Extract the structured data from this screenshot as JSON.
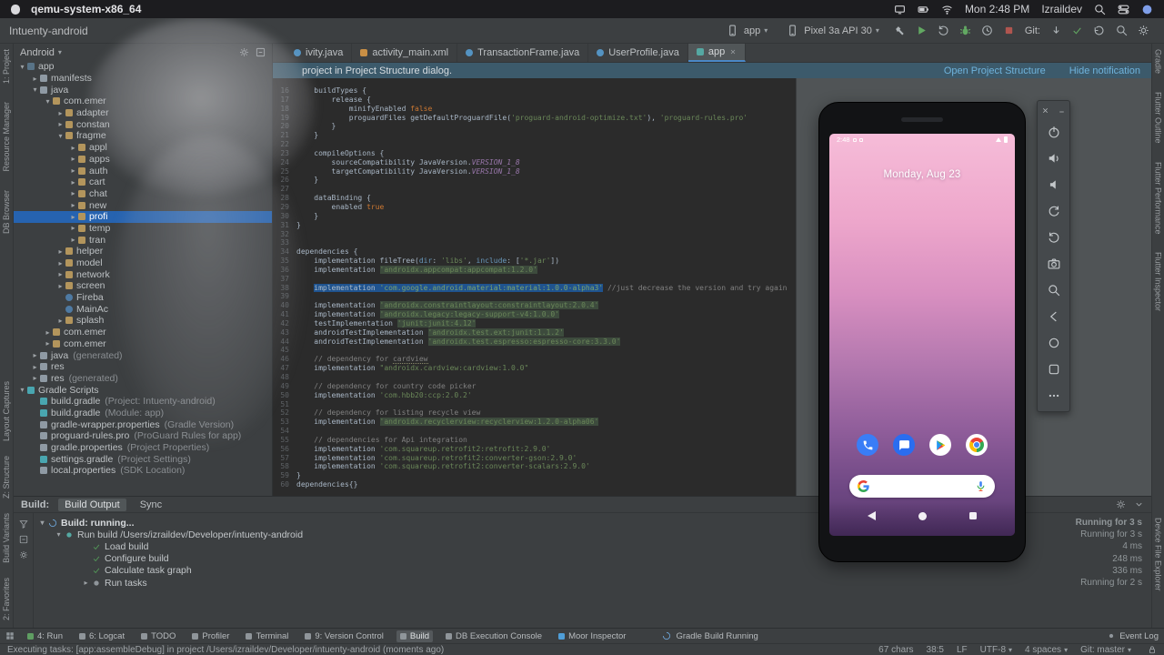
{
  "menubar": {
    "app_name": "qemu-system-x86_64",
    "time": "Mon 2:48 PM",
    "user": "Izraildev",
    "status_icons": [
      {
        "i": "display",
        "n": "display-icon"
      },
      {
        "i": "battery",
        "n": "battery-icon"
      },
      {
        "i": "wifi",
        "n": "wifi-icon"
      }
    ]
  },
  "toolbar": {
    "project": "Intuenty-android",
    "run_config": "app",
    "device": "Pixel 3a API 30",
    "git_label": "Git:",
    "actions": [
      {
        "i": "hammer",
        "n": "build-hammer-icon",
        "cls": "c-gray"
      },
      {
        "i": "play",
        "n": "run-icon",
        "cls": "c-green"
      },
      {
        "i": "rotate-right",
        "n": "apply-changes-icon",
        "cls": "c-gray"
      },
      {
        "i": "bug",
        "n": "debug-icon",
        "cls": "c-green"
      },
      {
        "i": "clock",
        "n": "profile-icon",
        "cls": "c-gray"
      },
      {
        "i": "stop",
        "n": "stop-icon",
        "cls": "c-red"
      }
    ],
    "git_icons": [
      {
        "i": "arrow-down",
        "n": "git-update-icon",
        "cls": "c-gray"
      },
      {
        "i": "check",
        "n": "git-commit-icon",
        "cls": "c-green"
      },
      {
        "i": "undo",
        "n": "git-rollback-icon",
        "cls": "c-gray"
      }
    ],
    "trailing_icons": [
      {
        "i": "search",
        "n": "search-icon",
        "cls": "c-gray"
      },
      {
        "i": "gear",
        "n": "settings-icon",
        "cls": "c-gray"
      }
    ]
  },
  "left_strip_top": [
    "1: Project",
    "Resource Manager",
    "DB Browser"
  ],
  "left_strip_bottom": [
    "Layout Captures",
    "Z: Structure",
    "Build Variants",
    "2: Favorites"
  ],
  "right_strip_top": [
    "Gradle",
    "Flutter Outline",
    "Flutter Performance",
    "Flutter Inspector"
  ],
  "right_strip_bottom": [
    "Device File Explorer"
  ],
  "project_panel": {
    "scope": "Android",
    "tree": [
      {
        "l": "app",
        "cls": "d0",
        "ic": "ic-app",
        "a": "▾"
      },
      {
        "l": "manifests",
        "cls": "d1",
        "ic": "ic-folder",
        "a": "▸"
      },
      {
        "l": "java",
        "cls": "d1",
        "ic": "ic-folder",
        "a": "▾"
      },
      {
        "l": "com.emer",
        "cls": "d2",
        "ic": "ic-pkg",
        "a": "▾"
      },
      {
        "l": "adapter",
        "cls": "d3",
        "ic": "ic-pkg",
        "a": "▸"
      },
      {
        "l": "constan",
        "cls": "d3",
        "ic": "ic-pkg",
        "a": "▸"
      },
      {
        "l": "fragme",
        "cls": "d3",
        "ic": "ic-pkg",
        "a": "▾"
      },
      {
        "l": "appl",
        "cls": "d4",
        "ic": "ic-pkg",
        "a": "▸"
      },
      {
        "l": "apps",
        "cls": "d4",
        "ic": "ic-pkg",
        "a": "▸"
      },
      {
        "l": "auth",
        "cls": "d4",
        "ic": "ic-pkg",
        "a": "▸"
      },
      {
        "l": "cart",
        "cls": "d4",
        "ic": "ic-pkg",
        "a": "▸"
      },
      {
        "l": "chat",
        "cls": "d4",
        "ic": "ic-pkg",
        "a": "▸"
      },
      {
        "l": "new",
        "cls": "d4",
        "ic": "ic-pkg",
        "a": "▸"
      },
      {
        "l": "profi",
        "cls": "d4 selected",
        "ic": "ic-pkg",
        "a": "▸"
      },
      {
        "l": "temp",
        "cls": "d4",
        "ic": "ic-pkg",
        "a": "▸"
      },
      {
        "l": "tran",
        "cls": "d4",
        "ic": "ic-pkg",
        "a": "▸"
      },
      {
        "l": "helper",
        "cls": "d3",
        "ic": "ic-pkg",
        "a": "▸"
      },
      {
        "l": "model",
        "cls": "d3",
        "ic": "ic-pkg",
        "a": "▸"
      },
      {
        "l": "network",
        "cls": "d3",
        "ic": "ic-pkg",
        "a": "▸"
      },
      {
        "l": "screen",
        "cls": "d3",
        "ic": "ic-pkg",
        "a": "▸"
      },
      {
        "l": "Fireba",
        "cls": "d3",
        "ic": "ic-cls"
      },
      {
        "l": "MainAc",
        "cls": "d3",
        "ic": "ic-cls"
      },
      {
        "l": "splash",
        "cls": "d3",
        "ic": "ic-pkg",
        "a": "▸"
      },
      {
        "l": "com.emer",
        "cls": "d2",
        "ic": "ic-pkg",
        "a": "▸"
      },
      {
        "l": "com.emer",
        "cls": "d2",
        "ic": "ic-pkg",
        "a": "▸"
      },
      {
        "l": "java",
        "suf": "(generated)",
        "cls": "d1",
        "ic": "ic-folder",
        "a": "▸"
      },
      {
        "l": "res",
        "cls": "d1",
        "ic": "ic-folder",
        "a": "▸"
      },
      {
        "l": "res",
        "suf": "(generated)",
        "cls": "d1",
        "ic": "ic-folder",
        "a": "▸"
      },
      {
        "l": "Gradle Scripts",
        "cls": "d0",
        "ic": "ic-gradle",
        "a": "▾"
      },
      {
        "l": "build.gradle",
        "suf": "(Project: Intuenty-android)",
        "cls": "d1",
        "ic": "ic-gradle"
      },
      {
        "l": "build.gradle",
        "suf": "(Module: app)",
        "cls": "d1",
        "ic": "ic-gradle"
      },
      {
        "l": "gradle-wrapper.properties",
        "suf": "(Gradle Version)",
        "cls": "d1",
        "ic": "ic-props"
      },
      {
        "l": "proguard-rules.pro",
        "suf": "(ProGuard Rules for app)",
        "cls": "d1",
        "ic": "ic-pro"
      },
      {
        "l": "gradle.properties",
        "suf": "(Project Properties)",
        "cls": "d1",
        "ic": "ic-props"
      },
      {
        "l": "settings.gradle",
        "suf": "(Project Settings)",
        "cls": "d1",
        "ic": "ic-gradle"
      },
      {
        "l": "local.properties",
        "suf": "(SDK Location)",
        "cls": "d1",
        "ic": "ic-props"
      }
    ]
  },
  "tabs": [
    {
      "label": "ivity.java",
      "ic": "ti-java"
    },
    {
      "label": "activity_main.xml",
      "ic": "ti-xml"
    },
    {
      "label": "TransactionFrame.java",
      "ic": "ti-java"
    },
    {
      "label": "UserProfile.java",
      "ic": "ti-java"
    },
    {
      "label": "app",
      "ic": "ti-gradle",
      "cls": "active",
      "close": true
    }
  ],
  "notification": {
    "text": "project in Project Structure dialog.",
    "links": [
      "Open Project Structure",
      "Hide notification"
    ]
  },
  "editor": {
    "lines": [
      {
        "g": 16,
        "s": [
          {
            "t": "    buildTypes {",
            "c": "pln"
          }
        ]
      },
      {
        "g": 17,
        "s": [
          {
            "t": "        release {",
            "c": "pln"
          }
        ]
      },
      {
        "g": 18,
        "s": [
          {
            "t": "            minifyEnabled ",
            "c": "pln"
          },
          {
            "t": "false",
            "c": "kw"
          }
        ]
      },
      {
        "g": 19,
        "s": [
          {
            "t": "            proguardFiles getDefaultProguardFile(",
            "c": "pln"
          },
          {
            "t": "'proguard-android-optimize.txt'",
            "c": "str"
          },
          {
            "t": "), ",
            "c": "pln"
          },
          {
            "t": "'proguard-rules.pro'",
            "c": "str"
          }
        ]
      },
      {
        "g": 20,
        "s": [
          {
            "t": "        }",
            "c": "pln"
          }
        ]
      },
      {
        "g": 21,
        "s": [
          {
            "t": "    }",
            "c": "pln"
          }
        ]
      },
      {
        "g": 22,
        "s": []
      },
      {
        "g": 23,
        "s": [
          {
            "t": "    compileOptions {",
            "c": "pln"
          }
        ]
      },
      {
        "g": 24,
        "s": [
          {
            "t": "        sourceCompatibility JavaVersion.",
            "c": "pln"
          },
          {
            "t": "VERSION_1_8",
            "c": "cst"
          }
        ]
      },
      {
        "g": 25,
        "s": [
          {
            "t": "        targetCompatibility JavaVersion.",
            "c": "pln"
          },
          {
            "t": "VERSION_1_8",
            "c": "cst"
          }
        ]
      },
      {
        "g": 26,
        "s": [
          {
            "t": "    }",
            "c": "pln"
          }
        ]
      },
      {
        "g": 27,
        "s": []
      },
      {
        "g": 28,
        "s": [
          {
            "t": "    dataBinding {",
            "c": "pln"
          }
        ]
      },
      {
        "g": 29,
        "s": [
          {
            "t": "        enabled ",
            "c": "pln"
          },
          {
            "t": "true",
            "c": "kw"
          }
        ]
      },
      {
        "g": 30,
        "s": [
          {
            "t": "    }",
            "c": "pln"
          }
        ]
      },
      {
        "g": 31,
        "s": [
          {
            "t": "}",
            "c": "pln"
          }
        ]
      },
      {
        "g": 32,
        "s": []
      },
      {
        "g": 33,
        "s": []
      },
      {
        "g": 34,
        "s": [
          {
            "t": "dependencies {",
            "c": "pln"
          }
        ]
      },
      {
        "g": 35,
        "s": [
          {
            "t": "    implementation fileTree(",
            "c": "pln"
          },
          {
            "t": "dir",
            "c": "prm"
          },
          {
            "t": ": ",
            "c": "pln"
          },
          {
            "t": "'libs'",
            "c": "str"
          },
          {
            "t": ", ",
            "c": "pln"
          },
          {
            "t": "include",
            "c": "prm"
          },
          {
            "t": ": [",
            "c": "pln"
          },
          {
            "t": "'*.jar'",
            "c": "str"
          },
          {
            "t": "])",
            "c": "pln"
          }
        ]
      },
      {
        "g": 36,
        "s": [
          {
            "t": "    implementation ",
            "c": "pln"
          },
          {
            "t": "'androidx.appcompat:appcompat:1.2.0'",
            "c": "strh"
          }
        ]
      },
      {
        "g": 37,
        "s": []
      },
      {
        "g": 38,
        "s": [
          {
            "t": "    ",
            "c": "pln"
          },
          {
            "t": "implementation ",
            "c": "sel"
          },
          {
            "t": "'com.google.android.material:material:1.0.0-alpha3'",
            "c": "selstr"
          },
          {
            "t": " ",
            "c": "pln"
          },
          {
            "t": "//just decrease the version and try again",
            "c": "cmt"
          }
        ]
      },
      {
        "g": 39,
        "s": []
      },
      {
        "g": 40,
        "s": [
          {
            "t": "    implementation ",
            "c": "pln"
          },
          {
            "t": "'androidx.constraintlayout:constraintlayout:2.0.4'",
            "c": "strh"
          }
        ]
      },
      {
        "g": 41,
        "s": [
          {
            "t": "    implementation ",
            "c": "pln"
          },
          {
            "t": "'androidx.legacy:legacy-support-v4:1.0.0'",
            "c": "strh"
          }
        ]
      },
      {
        "g": 42,
        "s": [
          {
            "t": "    testImplementation ",
            "c": "pln"
          },
          {
            "t": "'junit:junit:4.12'",
            "c": "strh"
          }
        ]
      },
      {
        "g": 43,
        "s": [
          {
            "t": "    androidTestImplementation ",
            "c": "pln"
          },
          {
            "t": "'androidx.test.ext:junit:1.1.2'",
            "c": "strh"
          }
        ]
      },
      {
        "g": 44,
        "s": [
          {
            "t": "    androidTestImplementation ",
            "c": "pln"
          },
          {
            "t": "'androidx.test.espresso:espresso-core:3.3.0'",
            "c": "strh"
          }
        ]
      },
      {
        "g": 45,
        "s": []
      },
      {
        "g": 46,
        "s": [
          {
            "t": "    ",
            "c": "pln"
          },
          {
            "t": "// dependency for ",
            "c": "cmt"
          },
          {
            "t": "cardview",
            "c": "cmt u"
          }
        ]
      },
      {
        "g": 47,
        "s": [
          {
            "t": "    implementation ",
            "c": "pln"
          },
          {
            "t": "\"androidx.cardview:cardview:1.0.0\"",
            "c": "str"
          }
        ]
      },
      {
        "g": 48,
        "s": []
      },
      {
        "g": 49,
        "s": [
          {
            "t": "    ",
            "c": "pln"
          },
          {
            "t": "// dependency for country code picker",
            "c": "cmt"
          }
        ]
      },
      {
        "g": 50,
        "s": [
          {
            "t": "    implementation ",
            "c": "pln"
          },
          {
            "t": "'com.hbb20:ccp:2.0.2'",
            "c": "str"
          }
        ]
      },
      {
        "g": 51,
        "s": []
      },
      {
        "g": 52,
        "s": [
          {
            "t": "    ",
            "c": "pln"
          },
          {
            "t": "// dependency for listing recycle view",
            "c": "cmt"
          }
        ]
      },
      {
        "g": 53,
        "s": [
          {
            "t": "    implementation ",
            "c": "pln"
          },
          {
            "t": "'androidx.recyclerview:recyclerview:1.2.0-alpha06'",
            "c": "strh"
          }
        ]
      },
      {
        "g": 54,
        "s": []
      },
      {
        "g": 55,
        "s": [
          {
            "t": "    ",
            "c": "pln"
          },
          {
            "t": "// dependencies for Api integration",
            "c": "cmt"
          }
        ]
      },
      {
        "g": 56,
        "s": [
          {
            "t": "    implementation ",
            "c": "pln"
          },
          {
            "t": "'com.squareup.retrofit2:retrofit:2.9.0'",
            "c": "str"
          }
        ]
      },
      {
        "g": 57,
        "s": [
          {
            "t": "    implementation ",
            "c": "pln"
          },
          {
            "t": "'com.squareup.retrofit2:converter-gson:2.9.0'",
            "c": "str"
          }
        ]
      },
      {
        "g": 58,
        "s": [
          {
            "t": "    implementation ",
            "c": "pln"
          },
          {
            "t": "'com.squareup.retrofit2:converter-scalars:2.9.0'",
            "c": "str"
          }
        ]
      },
      {
        "g": 59,
        "s": [
          {
            "t": "}",
            "c": "pln"
          }
        ]
      },
      {
        "g": 60,
        "s": [
          {
            "t": "dependencies{}",
            "c": "pln"
          }
        ]
      }
    ]
  },
  "emulator": {
    "controls": [
      {
        "i": "power",
        "n": "power-button"
      },
      {
        "i": "volume-up",
        "n": "volume-up-button"
      },
      {
        "i": "volume-down",
        "n": "volume-down-button"
      },
      {
        "i": "rotate-left",
        "n": "rotate-left-button"
      },
      {
        "i": "rotate-right",
        "n": "rotate-right-button"
      },
      {
        "i": "camera",
        "n": "screenshot-button"
      },
      {
        "i": "zoom",
        "n": "zoom-button"
      },
      {
        "i": "back-nav",
        "n": "back-button"
      },
      {
        "i": "home-nav",
        "n": "home-button"
      },
      {
        "i": "overview-nav",
        "n": "overview-button"
      },
      {
        "i": "more",
        "n": "more-button"
      }
    ],
    "phone": {
      "status_time": "2:48",
      "date": "Monday, Aug 23",
      "dock": [
        {
          "ic": "phone-call",
          "cls": "di-phone",
          "n": "phone-app-icon"
        },
        {
          "ic": "chat",
          "cls": "di-msg",
          "n": "messages-app-icon"
        },
        {
          "ic": "gplay",
          "cls": "di-play",
          "n": "play-store-app-icon"
        },
        {
          "ic": "chrome",
          "cls": "di-chrome",
          "n": "chrome-app-icon"
        }
      ]
    }
  },
  "build_panel": {
    "label": "Build:",
    "tabs": [
      {
        "label": "Build Output",
        "cls": "active"
      },
      {
        "label": "Sync"
      }
    ],
    "header_icons": [
      {
        "i": "gear",
        "n": "build-settings-icon"
      },
      {
        "i": "chevron-down",
        "n": "collapse-panel-icon"
      }
    ],
    "side_icons": [
      {
        "i": "funnel",
        "n": "filter-icon"
      },
      {
        "i": "collapse",
        "n": "collapse-all-icon"
      },
      {
        "i": "gear",
        "n": "build-options-icon"
      }
    ],
    "rows": [
      {
        "pre": "▾",
        "ic": "spinner",
        "label": "Build: running...",
        "dur": "Running for 3 s",
        "cls": "b0 bold spin-blue"
      },
      {
        "pre": "▾",
        "ic": "gradle-dot",
        "label": "Run build /Users/izraildev/Developer/intuenty-android",
        "dur": "Running for 3 s",
        "cls": "b1"
      },
      {
        "ic": "check",
        "label": "Load build",
        "dur": "4 ms",
        "cls": "b2 chk-green"
      },
      {
        "ic": "check",
        "label": "Configure build",
        "dur": "248 ms",
        "cls": "b2 chk-green"
      },
      {
        "ic": "check",
        "label": "Calculate task graph",
        "dur": "336 ms",
        "cls": "b2 chk-green"
      },
      {
        "pre": "▸",
        "ic": "run-dot",
        "label": "Run tasks",
        "dur": "Running for 2 s",
        "cls": "b2"
      }
    ]
  },
  "bottom_bar": {
    "items": [
      {
        "label": "4: Run",
        "ic": "bi-run"
      },
      {
        "label": "6: Logcat",
        "ic": "bi-gray"
      },
      {
        "label": "TODO",
        "ic": "bi-gray"
      },
      {
        "label": "Profiler",
        "ic": "bi-gray"
      },
      {
        "label": "Terminal",
        "ic": "bi-gray"
      },
      {
        "label": "9: Version Control",
        "ic": "bi-gray"
      },
      {
        "label": "Build",
        "ic": "bi-gray",
        "cls": "active"
      },
      {
        "label": "DB Execution Console",
        "ic": "bi-gray"
      },
      {
        "label": "Moor Inspector",
        "ic": "bi-blue"
      }
    ],
    "progress": "Gradle Build Running",
    "event_log": "Event Log"
  },
  "status_bar": {
    "message": "Executing tasks: [app:assembleDebug] in project /Users/izraildev/Developer/intuenty-android (moments ago)",
    "items": [
      {
        "t": "67 chars"
      },
      {
        "t": "38:5"
      },
      {
        "t": "LF"
      },
      {
        "t": "UTF-8",
        "caret": true
      },
      {
        "t": "4 spaces",
        "caret": true
      },
      {
        "t": "Git: master",
        "caret": true
      }
    ]
  }
}
